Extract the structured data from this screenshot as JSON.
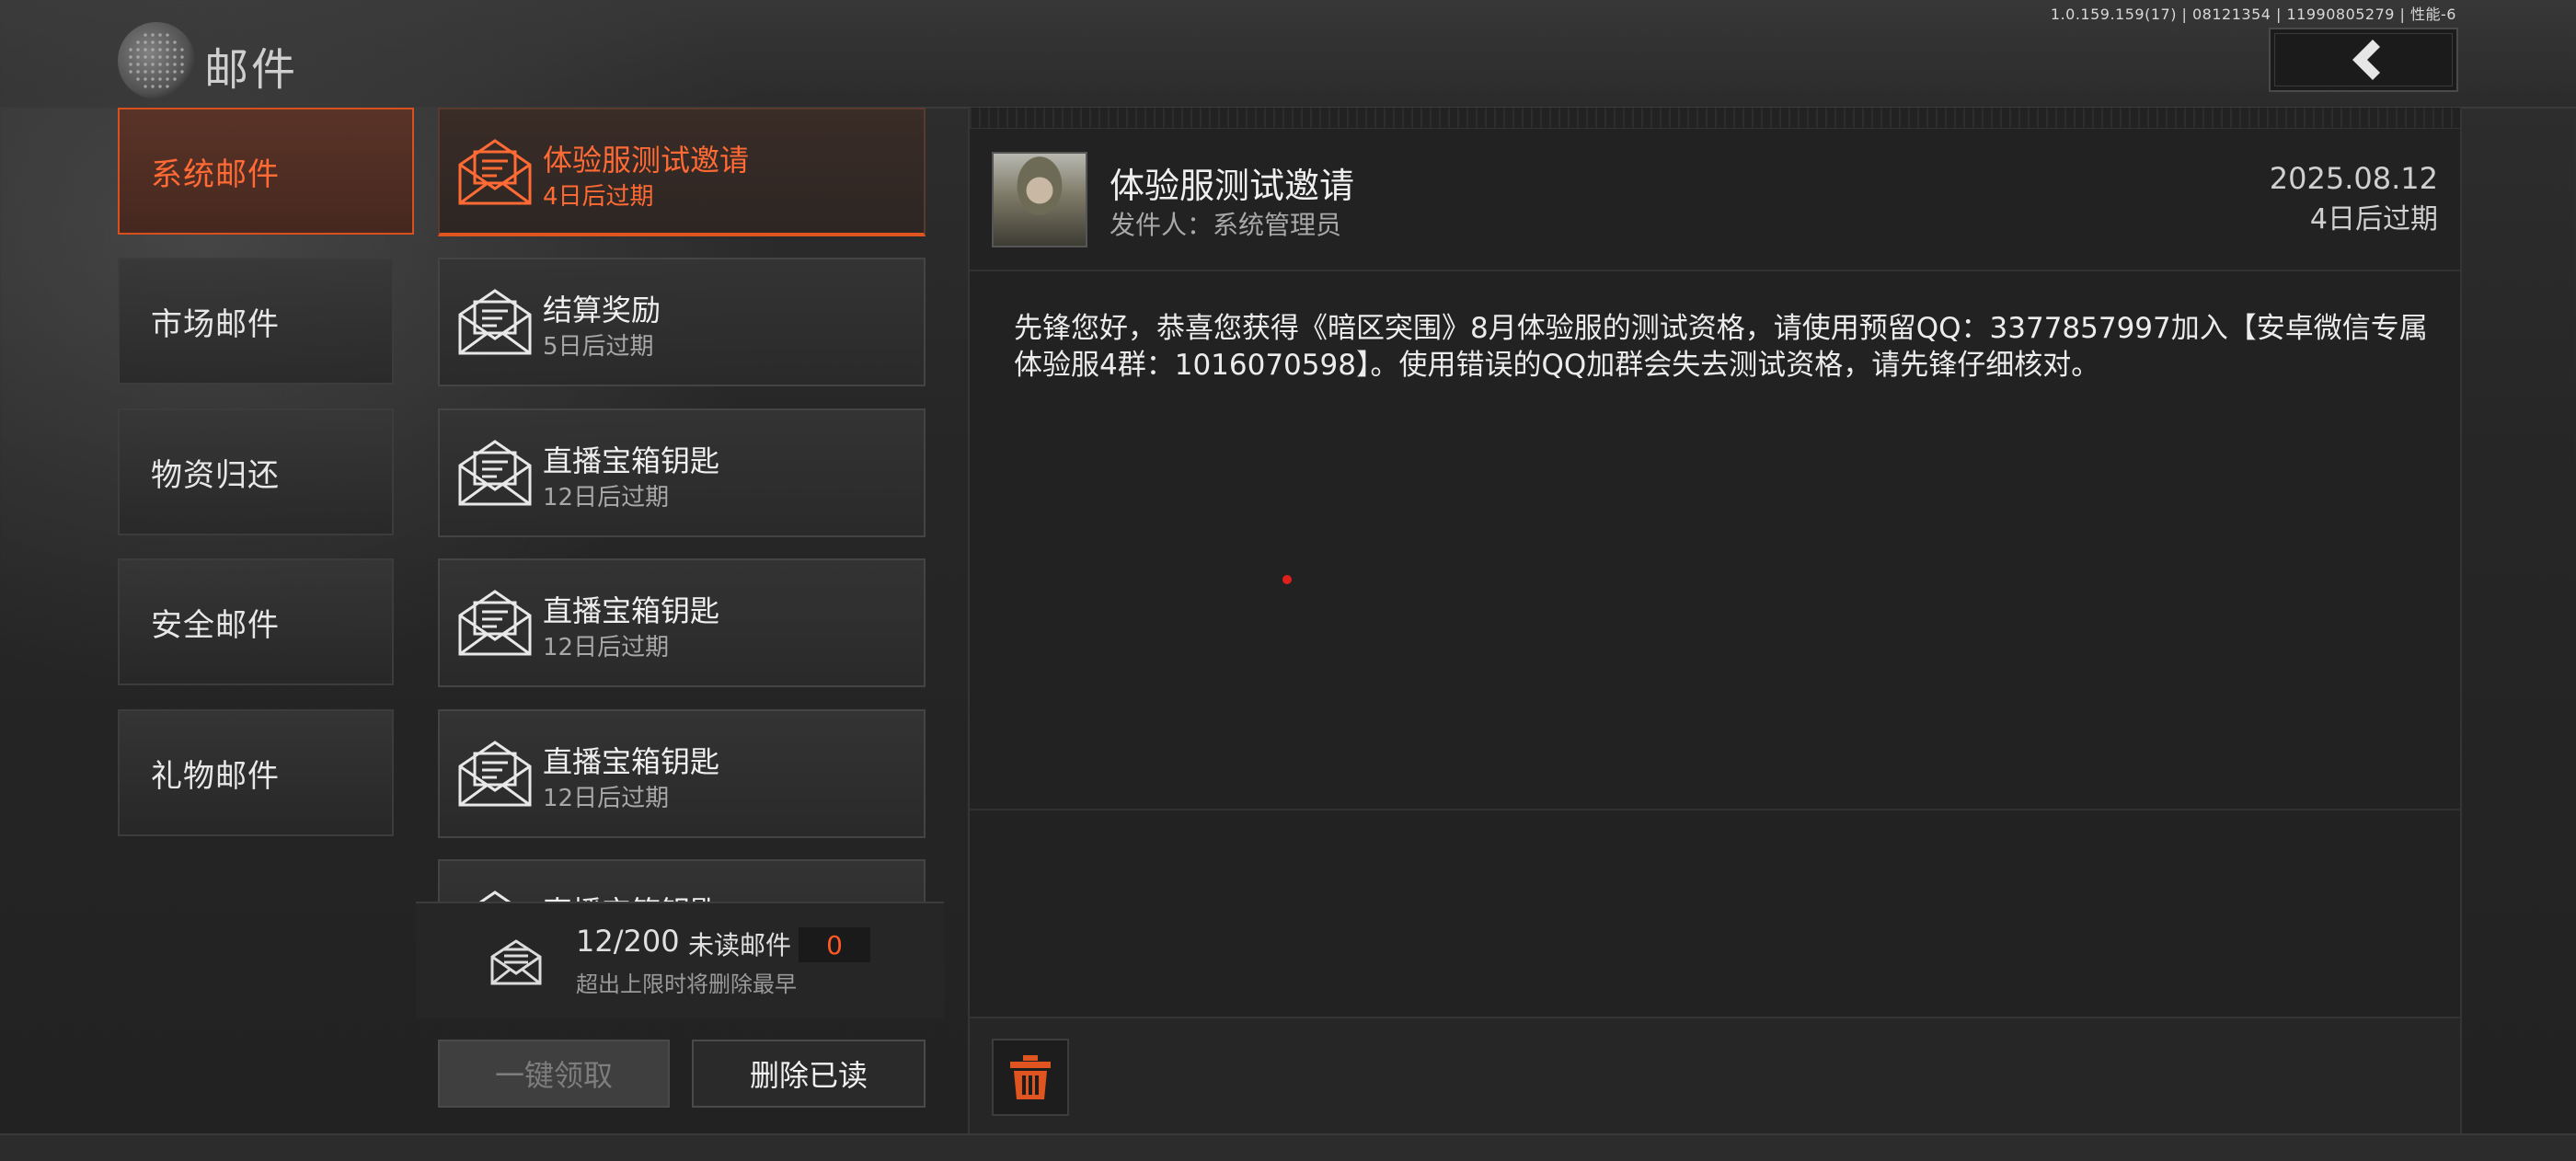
{
  "header": {
    "build_info": "1.0.159.159(17) | 08121354 | 11990805279 | 性能-6",
    "title": "邮件",
    "back_icon": "chevron-left-icon"
  },
  "categories": [
    {
      "label": "系统邮件",
      "active": true
    },
    {
      "label": "市场邮件",
      "active": false
    },
    {
      "label": "物资归还",
      "active": false
    },
    {
      "label": "安全邮件",
      "active": false
    },
    {
      "label": "礼物邮件",
      "active": false
    }
  ],
  "mails": [
    {
      "title": "体验服测试邀请",
      "expiry": "4日后过期",
      "active": true
    },
    {
      "title": "结算奖励",
      "expiry": "5日后过期",
      "active": false
    },
    {
      "title": "直播宝箱钥匙",
      "expiry": "12日后过期",
      "active": false
    },
    {
      "title": "直播宝箱钥匙",
      "expiry": "12日后过期",
      "active": false
    },
    {
      "title": "直播宝箱钥匙",
      "expiry": "12日后过期",
      "active": false
    },
    {
      "title": "直播宝箱钥匙",
      "expiry": "",
      "active": false
    }
  ],
  "list_footer": {
    "count": "12/200",
    "unread_label": "未读邮件",
    "unread_count": "0",
    "limit_note": "超出上限时将删除最早",
    "claim_all": "一键领取",
    "delete_read": "删除已读"
  },
  "detail": {
    "title": "体验服测试邀请",
    "sender": "发件人：系统管理员",
    "date": "2025.08.12",
    "expiry": "4日后过期",
    "body": "先锋您好，恭喜您获得《暗区突围》8月体验服的测试资格，请使用预留QQ：3377857997加入【安卓微信专属体验服4群：1016070598】。使用错误的QQ加群会失去测试资格，请先锋仔细核对。",
    "trash_icon": "trash-icon"
  },
  "colors": {
    "accent": "#e0541f",
    "accent_text": "#ff6a35",
    "panel": "#222222"
  }
}
